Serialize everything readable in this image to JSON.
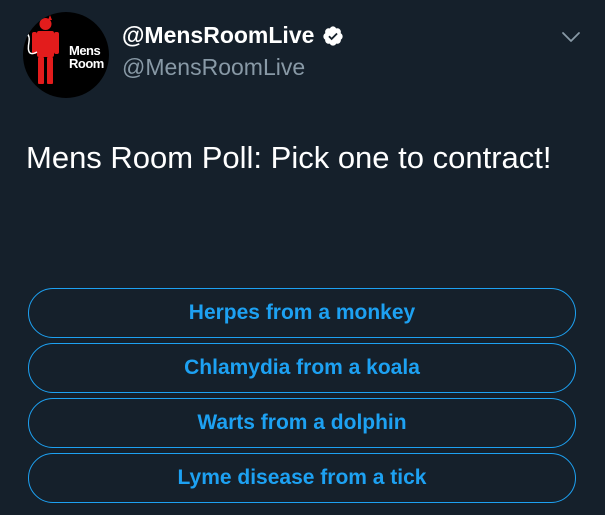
{
  "author": {
    "avatar_text_line1": "Mens",
    "avatar_text_line2": "Room",
    "display_name": "@MensRoomLive",
    "handle": "@MensRoomLive",
    "verified": true,
    "avatar_icon": "devil-figure-icon",
    "avatar_color": "#e31c1c"
  },
  "tweet": {
    "text": "Mens Room Poll: Pick one to contract!"
  },
  "poll": {
    "options": [
      "Herpes from a monkey",
      "Chlamydia from a koala",
      "Warts from a dolphin",
      "Lyme disease from a tick"
    ]
  },
  "colors": {
    "background": "#15202b",
    "accent": "#1da1f2",
    "secondary_text": "#8899a6"
  }
}
